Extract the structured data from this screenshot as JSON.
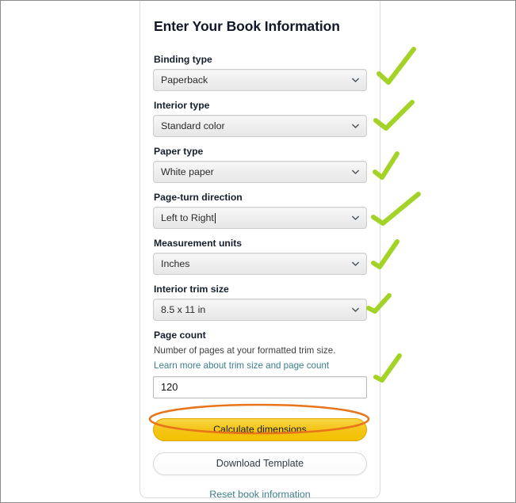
{
  "card": {
    "title": "Enter Your Book Information",
    "fields": [
      {
        "label": "Binding type",
        "value": "Paperback",
        "name": "binding-type"
      },
      {
        "label": "Interior type",
        "value": "Standard color",
        "name": "interior-type"
      },
      {
        "label": "Paper type",
        "value": "White paper",
        "name": "paper-type"
      },
      {
        "label": "Page-turn direction",
        "value": "Left to Right",
        "name": "page-turn-direction"
      },
      {
        "label": "Measurement units",
        "value": "Inches",
        "name": "measurement-units"
      },
      {
        "label": "Interior trim size",
        "value": "8.5 x 11 in",
        "name": "interior-trim-size"
      }
    ],
    "page_count": {
      "label": "Page count",
      "help_text": "Number of pages at your formatted trim size.",
      "help_link": "Learn more about trim size and page count",
      "value": "120",
      "placeholder": "Page count"
    },
    "actions": {
      "calculate_label": "Calculate dimensions",
      "download_label": "Download Template",
      "reset_label": "Reset book information"
    },
    "icons": {
      "chevron": "chevron-down-icon",
      "check": "checkmark-annotation-icon",
      "ellipse": "ellipse-highlight-annotation"
    }
  },
  "colors": {
    "annotation_check": "#a4d328",
    "annotation_ellipse": "#e8751a",
    "primary_button": "#f5c518",
    "link": "#3b7f8c",
    "label": "#14202e",
    "card_border": "#dcdcdc",
    "page_border": "#8c8c8c"
  },
  "annotations": {
    "checks": [
      {
        "target": "binding-type"
      },
      {
        "target": "interior-type"
      },
      {
        "target": "paper-type"
      },
      {
        "target": "page-turn-direction"
      },
      {
        "target": "measurement-units"
      },
      {
        "target": "interior-trim-size"
      },
      {
        "target": "page-count"
      }
    ],
    "ellipse": {
      "target": "calculate-dimensions-button"
    }
  }
}
